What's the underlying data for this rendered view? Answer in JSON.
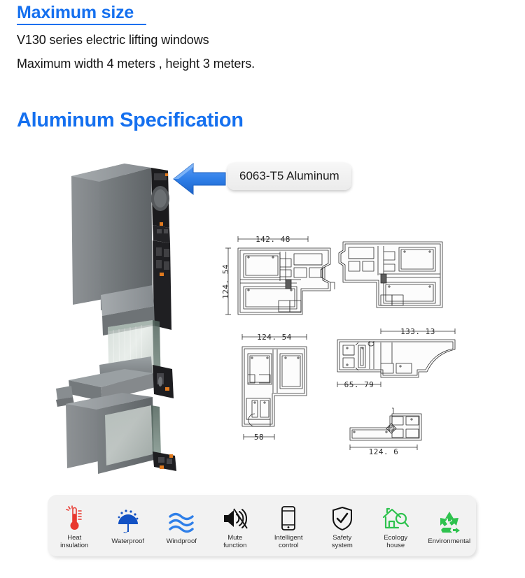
{
  "sections": {
    "max_size": {
      "heading": "Maximum size",
      "line1": "V130 series electric lifting windows",
      "line2": "Maximum width 4 meters , height 3 meters."
    },
    "aluminum": {
      "heading": "Aluminum Specification",
      "callout_label": "6063-T5 Aluminum"
    }
  },
  "colors": {
    "heading_blue": "#1570ef",
    "arrow_blue": "#2f7fe8",
    "panel_bg": "#f2f2f2",
    "icon_red": "#e8382f",
    "icon_blue": "#1352c4",
    "icon_wave_blue": "#2f7fe8",
    "icon_black": "#111111",
    "icon_green": "#2ec24e"
  },
  "drawings": [
    {
      "id": "cad1",
      "name": "profile-section-1",
      "width_label": "142. 48",
      "height_label": "124. 54"
    },
    {
      "id": "cad2",
      "name": "profile-section-2",
      "width_label": "",
      "height_label": ""
    },
    {
      "id": "cad3",
      "name": "profile-section-3",
      "width_label": "124. 54",
      "bottom_label": "58"
    },
    {
      "id": "cad4",
      "name": "profile-section-4",
      "width_label": "133. 13",
      "bottom_label": "65. 79"
    },
    {
      "id": "cad5",
      "name": "profile-section-5",
      "width_label": "124. 6"
    }
  ],
  "features": [
    {
      "icon": "thermometer-icon",
      "label": "Heat\ninsulation"
    },
    {
      "icon": "umbrella-rain-icon",
      "label": "Waterproof"
    },
    {
      "icon": "wind-waves-icon",
      "label": "Windproof"
    },
    {
      "icon": "speaker-mute-icon",
      "label": "Mute\nfunction"
    },
    {
      "icon": "tablet-icon",
      "label": "Intelligent\ncontrol"
    },
    {
      "icon": "shield-check-icon",
      "label": "Safety\nsystem"
    },
    {
      "icon": "house-magnifier-icon",
      "label": "Ecology\nhouse"
    },
    {
      "icon": "recycle-icon",
      "label": "Environmental"
    }
  ]
}
